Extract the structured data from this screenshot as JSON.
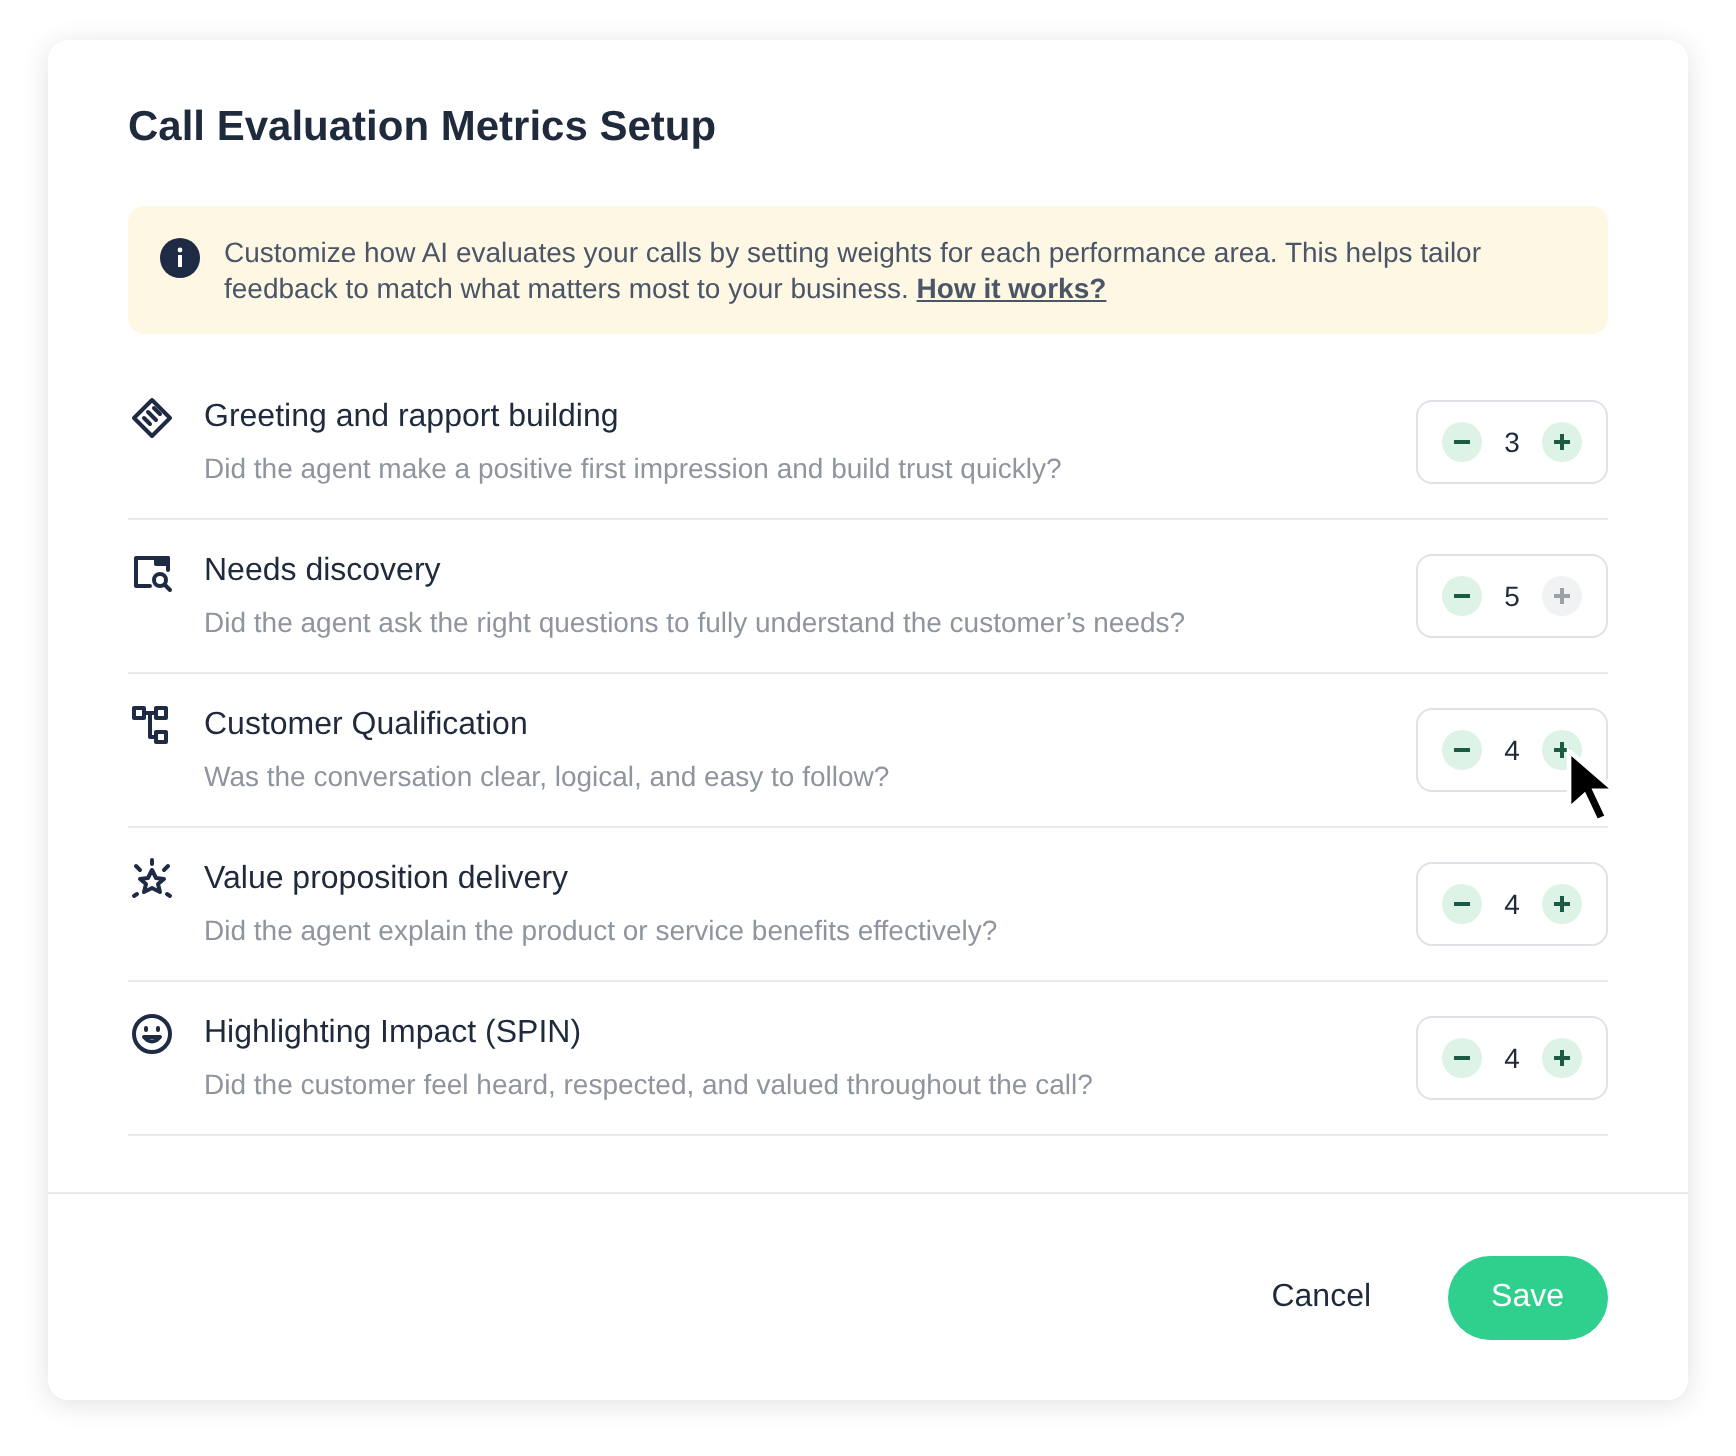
{
  "dialog": {
    "title": "Call Evaluation Metrics Setup"
  },
  "info_banner": {
    "text": "Customize how AI evaluates your calls by setting weights for each performance area. This helps tailor feedback to match what matters most to your business.",
    "link": "How it works?"
  },
  "metrics": [
    {
      "title": "Greeting and rapport building",
      "description": "Did the agent make a positive first impression and build trust quickly?",
      "value": "3",
      "plus_disabled": false,
      "cursor": false
    },
    {
      "title": "Needs discovery",
      "description": "Did the agent ask the right questions to fully understand the customer’s needs?",
      "value": "5",
      "plus_disabled": true,
      "cursor": false
    },
    {
      "title": "Customer Qualification",
      "description": "Was the conversation clear, logical, and easy to follow?",
      "value": "4",
      "plus_disabled": false,
      "cursor": true
    },
    {
      "title": "Value proposition delivery",
      "description": "Did the agent explain the product or service benefits effectively?",
      "value": "4",
      "plus_disabled": false,
      "cursor": false
    },
    {
      "title": "Highlighting Impact (SPIN)",
      "description": "Did the customer feel heard, respected, and valued throughout the call?",
      "value": "4",
      "plus_disabled": false,
      "cursor": false
    }
  ],
  "buttons": [
    {
      "kind": "secondary",
      "label": "Cancel"
    },
    {
      "kind": "primary",
      "label": "Save"
    }
  ]
}
